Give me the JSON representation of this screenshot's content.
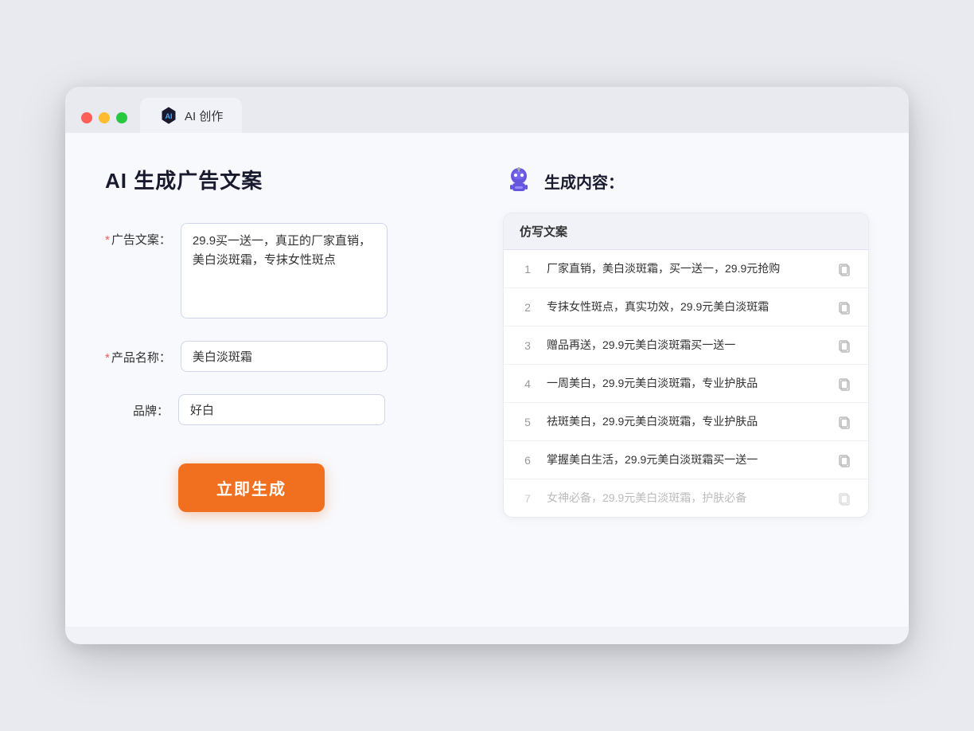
{
  "window": {
    "tab_label": "AI 创作"
  },
  "left": {
    "page_title": "AI 生成广告文案",
    "fields": [
      {
        "id": "ad_copy",
        "label": "广告文案：",
        "required": true,
        "type": "textarea",
        "value": "29.9买一送一，真正的厂家直销，美白淡斑霜，专抹女性斑点"
      },
      {
        "id": "product_name",
        "label": "产品名称：",
        "required": true,
        "type": "input",
        "value": "美白淡斑霜"
      },
      {
        "id": "brand",
        "label": "品牌：",
        "required": false,
        "type": "input",
        "value": "好白"
      }
    ],
    "button_label": "立即生成"
  },
  "right": {
    "title": "生成内容：",
    "table_header": "仿写文案",
    "results": [
      {
        "num": "1",
        "text": "厂家直销，美白淡斑霜，买一送一，29.9元抢购",
        "muted": false
      },
      {
        "num": "2",
        "text": "专抹女性斑点，真实功效，29.9元美白淡斑霜",
        "muted": false
      },
      {
        "num": "3",
        "text": "赠品再送，29.9元美白淡斑霜买一送一",
        "muted": false
      },
      {
        "num": "4",
        "text": "一周美白，29.9元美白淡斑霜，专业护肤品",
        "muted": false
      },
      {
        "num": "5",
        "text": "祛斑美白，29.9元美白淡斑霜，专业护肤品",
        "muted": false
      },
      {
        "num": "6",
        "text": "掌握美白生活，29.9元美白淡斑霜买一送一",
        "muted": false
      },
      {
        "num": "7",
        "text": "女神必备，29.9元美白淡斑霜，护肤必备",
        "muted": true
      }
    ]
  }
}
